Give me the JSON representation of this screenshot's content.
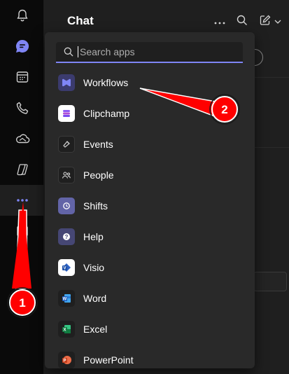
{
  "header": {
    "title": "Chat",
    "more_icon": "ellipsis-icon",
    "search_icon": "search-icon",
    "compose_icon": "compose-icon",
    "compose_menu_icon": "chevron-down-icon"
  },
  "rail": {
    "items": [
      {
        "name": "activity",
        "icon": "bell-icon"
      },
      {
        "name": "chat",
        "icon": "chat-icon"
      },
      {
        "name": "calendar",
        "icon": "calendar-icon"
      },
      {
        "name": "calls",
        "icon": "phone-icon"
      },
      {
        "name": "onedrive",
        "icon": "cloud-icon"
      },
      {
        "name": "copilot",
        "icon": "copilot-icon"
      },
      {
        "name": "more-apps",
        "icon": "ellipsis-icon"
      },
      {
        "name": "apps",
        "icon": "apps-icon"
      }
    ]
  },
  "flyout": {
    "search": {
      "placeholder": "Search apps",
      "value": ""
    },
    "apps": [
      {
        "label": "Workflows",
        "icon": "workflows-icon",
        "color": "#3b3b6e"
      },
      {
        "label": "Clipchamp",
        "icon": "clipchamp-icon",
        "color": "#ffffff"
      },
      {
        "label": "Events",
        "icon": "events-icon",
        "color": "#1f1f1f"
      },
      {
        "label": "People",
        "icon": "people-icon",
        "color": "#1f1f1f"
      },
      {
        "label": "Shifts",
        "icon": "shifts-icon",
        "color": "#6264a7"
      },
      {
        "label": "Help",
        "icon": "help-icon",
        "color": "#464775"
      },
      {
        "label": "Visio",
        "icon": "visio-icon",
        "color": "#ffffff"
      },
      {
        "label": "Word",
        "icon": "word-icon",
        "color": "#1f1f1f"
      },
      {
        "label": "Excel",
        "icon": "excel-icon",
        "color": "#1f1f1f"
      },
      {
        "label": "PowerPoint",
        "icon": "powerpoint-icon",
        "color": "#1f1f1f"
      }
    ]
  },
  "annotations": {
    "badge_1": "1",
    "badge_2": "2",
    "color": "#ff0000"
  },
  "colors": {
    "accent": "#7f85f5",
    "background": "#1f1f1f",
    "flyout": "#292929"
  }
}
